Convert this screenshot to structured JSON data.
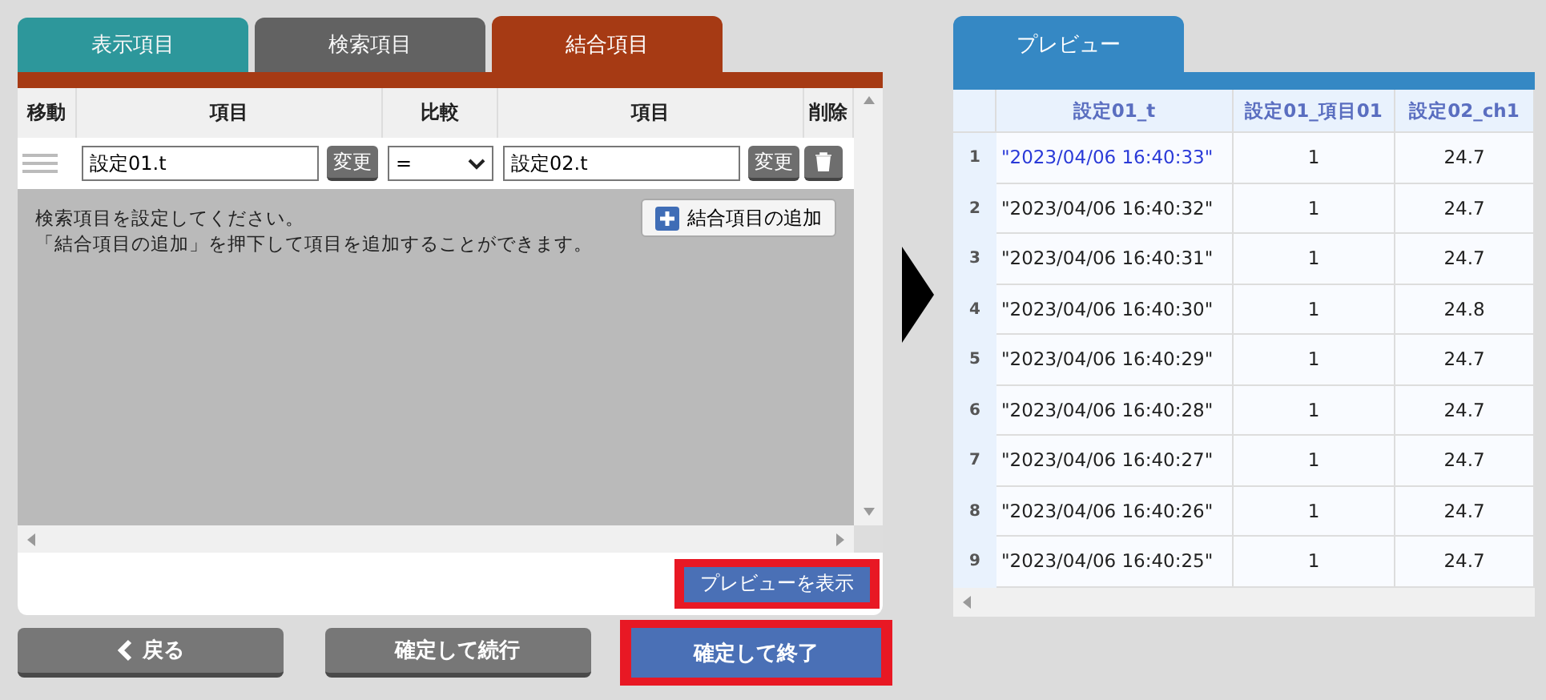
{
  "tabs": [
    {
      "label": "表示項目",
      "selected": false,
      "color": "#2e9ca0"
    },
    {
      "label": "検索項目",
      "selected": false,
      "color": "#656565"
    },
    {
      "label": "結合項目",
      "selected": true,
      "color": "#a63a14"
    }
  ],
  "join_table": {
    "columns": [
      "移動",
      "項目",
      "比較",
      "項目",
      "削除"
    ],
    "rows": [
      {
        "left_field": "設定01.t",
        "left_button": "変更",
        "operator": "=",
        "right_field": "設定02.t",
        "right_button": "変更"
      }
    ]
  },
  "help_text": [
    "検索項目を設定してください。",
    "「結合項目の追加」を押下して項目を追加することができます。"
  ],
  "add_button": "結合項目の追加",
  "preview_button": {
    "label": "プレビューを表示",
    "highlighted": true
  },
  "footer_buttons": [
    {
      "label": "戻る",
      "kind": "back",
      "highlighted": false
    },
    {
      "label": "確定して続行",
      "kind": "secondary",
      "highlighted": false
    },
    {
      "label": "確定して終了",
      "kind": "primary",
      "highlighted": true
    }
  ],
  "preview": {
    "tab": "プレビュー",
    "columns": [
      "設定01_t",
      "設定01_項目01",
      "設定02_ch1"
    ],
    "rows": [
      {
        "index": "1",
        "cells": [
          "\"2023/04/06 16:40:33\"",
          "1",
          "24.7"
        ],
        "selected": true
      },
      {
        "index": "2",
        "cells": [
          "\"2023/04/06 16:40:32\"",
          "1",
          "24.7"
        ],
        "selected": false
      },
      {
        "index": "3",
        "cells": [
          "\"2023/04/06 16:40:31\"",
          "1",
          "24.7"
        ],
        "selected": false
      },
      {
        "index": "4",
        "cells": [
          "\"2023/04/06 16:40:30\"",
          "1",
          "24.8"
        ],
        "selected": false
      },
      {
        "index": "5",
        "cells": [
          "\"2023/04/06 16:40:29\"",
          "1",
          "24.7"
        ],
        "selected": false
      },
      {
        "index": "6",
        "cells": [
          "\"2023/04/06 16:40:28\"",
          "1",
          "24.7"
        ],
        "selected": false
      },
      {
        "index": "7",
        "cells": [
          "\"2023/04/06 16:40:27\"",
          "1",
          "24.7"
        ],
        "selected": false
      },
      {
        "index": "8",
        "cells": [
          "\"2023/04/06 16:40:26\"",
          "1",
          "24.7"
        ],
        "selected": false
      },
      {
        "index": "9",
        "cells": [
          "\"2023/04/06 16:40:25\"",
          "1",
          "24.7"
        ],
        "selected": false
      }
    ]
  }
}
